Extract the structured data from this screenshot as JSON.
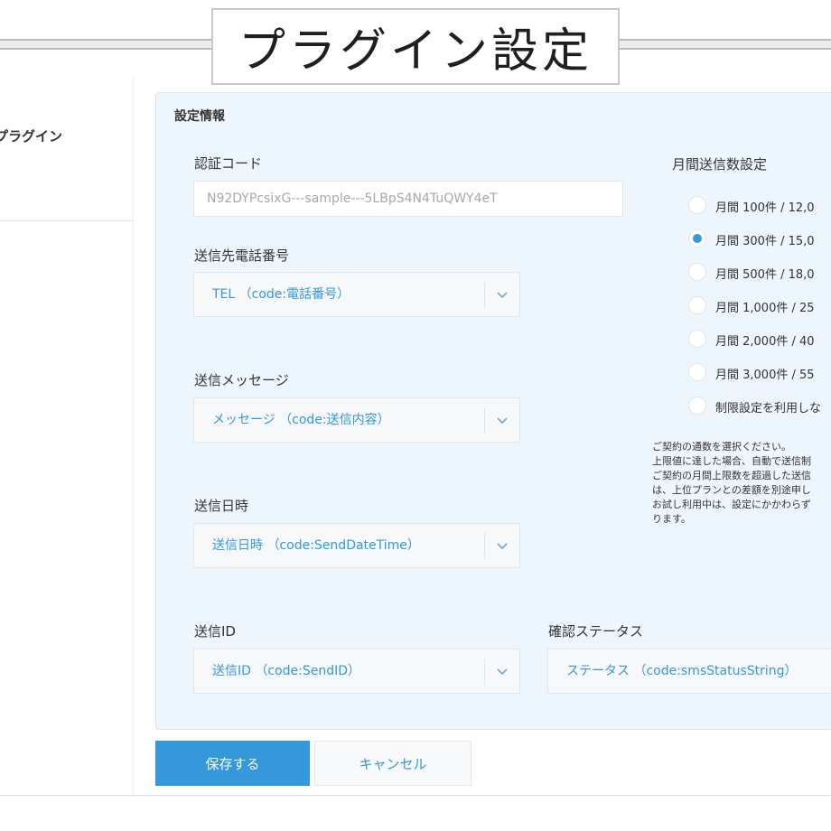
{
  "banner": {
    "title": "プラグイン設定"
  },
  "nav": {
    "plugin_label": "プラグイン"
  },
  "panel": {
    "title": "設定情報"
  },
  "auth": {
    "label": "認証コード",
    "value": "N92DYPcsixG---sample---5LBpS4N4TuQWY4eT"
  },
  "fields": {
    "phone": {
      "label": "送信先電話番号",
      "value": "TEL （code:電話番号）"
    },
    "message": {
      "label": "送信メッセージ",
      "value": "メッセージ （code:送信内容）"
    },
    "datetime": {
      "label": "送信日時",
      "value": "送信日時 （code:SendDateTime）"
    },
    "sendid": {
      "label": "送信ID",
      "value": "送信ID （code:SendID）"
    },
    "status": {
      "label": "確認ステータス",
      "value": "ステータス （code:smsStatusString）"
    }
  },
  "plan": {
    "title": "月間送信数設定",
    "selected_index": 1,
    "options": [
      "月間 100件 / 12,0",
      "月間 300件 / 15,0",
      "月間 500件 / 18,0",
      "月間 1,000件 / 25",
      "月間 2,000件 / 40",
      "月間 3,000件 / 55",
      "制限設定を利用しな"
    ],
    "note_lines": [
      "ご契約の通数を選択ください。",
      "上限値に達した場合、自動で送信制",
      "ご契約の月間上限数を超過した送信",
      "は、上位プランとの差額を別途申し",
      "お試し利用中は、設定にかかわらず",
      "ります。"
    ]
  },
  "buttons": {
    "save": "保存する",
    "cancel": "キャンセル"
  },
  "colors": {
    "accent": "#3498db",
    "panel_bg": "#eef6fd"
  }
}
